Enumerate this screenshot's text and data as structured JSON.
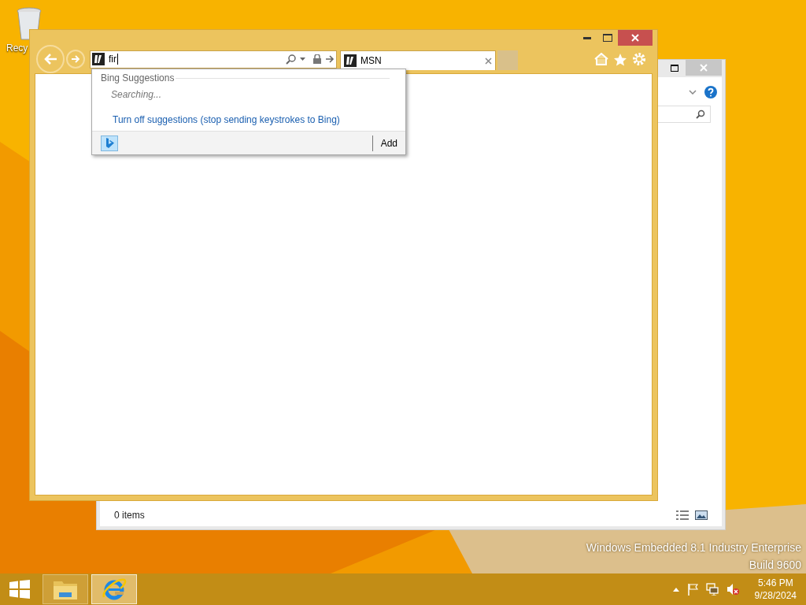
{
  "desktop": {
    "icons": [
      {
        "label": "Recy"
      }
    ],
    "edition_text": [
      "Windows Embedded 8.1 Industry Enterprise",
      "Build 9600"
    ]
  },
  "explorer_window": {
    "status": "0 items"
  },
  "browser": {
    "address": {
      "value": "fir"
    },
    "tabs": [
      {
        "label": "MSN",
        "selected": true
      }
    ],
    "dropdown": {
      "header": "Bing Suggestions",
      "status": "Searching...",
      "link": "Turn off suggestions (stop sending keystrokes to Bing)",
      "add_button": "Add"
    }
  },
  "taskbar": {
    "apps": [
      {
        "kind": "explorer",
        "selected": false
      },
      {
        "kind": "ie",
        "selected": true
      }
    ],
    "clock": {
      "time": "5:46 PM",
      "date": "9/28/2024"
    }
  }
}
